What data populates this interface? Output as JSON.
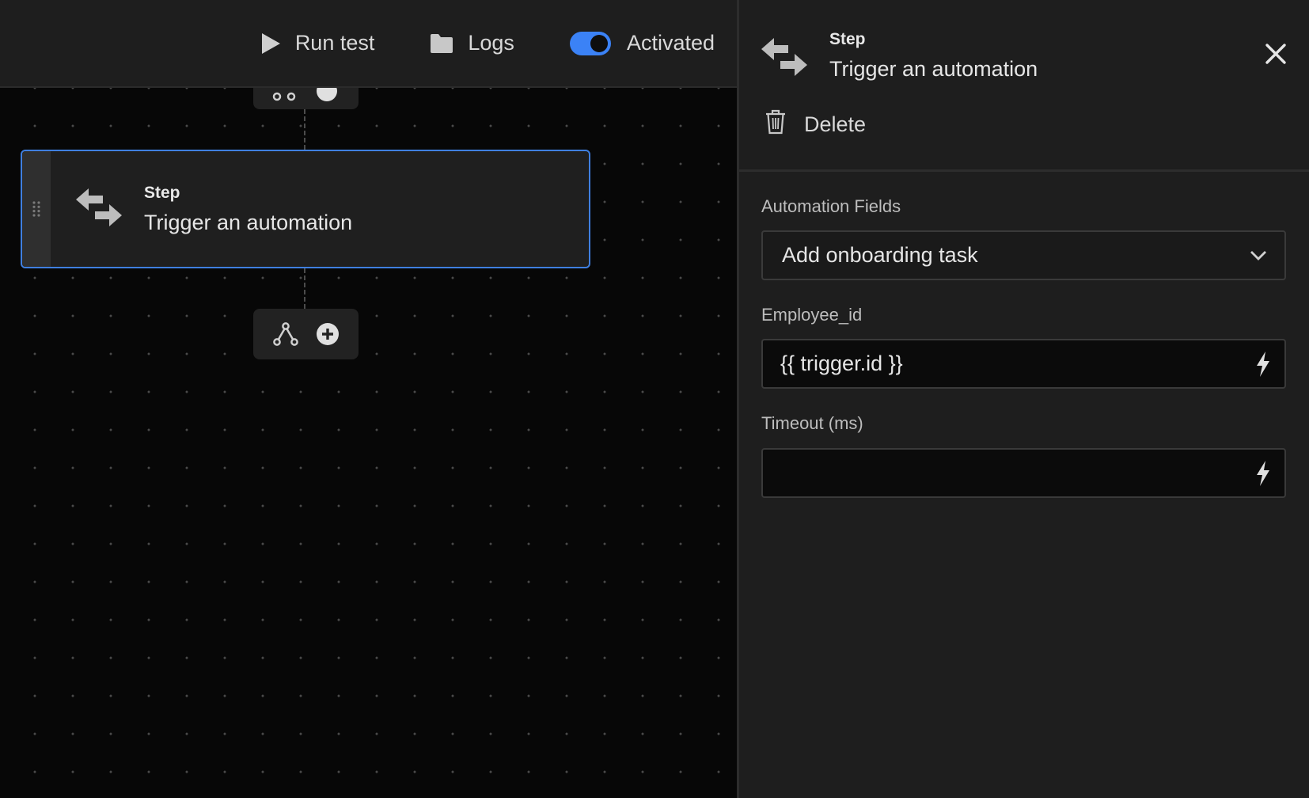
{
  "toolbar": {
    "run_test_label": "Run test",
    "logs_label": "Logs",
    "activated_label": "Activated",
    "activated": true
  },
  "canvas": {
    "step_card": {
      "type": "Step",
      "title": "Trigger an automation",
      "icon": "swap-arrows-icon"
    }
  },
  "panel": {
    "header": {
      "type": "Step",
      "title": "Trigger an automation",
      "icon": "swap-arrows-icon"
    },
    "delete_label": "Delete",
    "fields": {
      "automation_label": "Automation Fields",
      "automation_value": "Add onboarding task",
      "employee_id_label": "Employee_id",
      "employee_id_value": "{{ trigger.id }}",
      "timeout_label": "Timeout (ms)",
      "timeout_value": ""
    }
  },
  "colors": {
    "accent": "#3b82f6",
    "panel_bg": "#1e1e1e",
    "canvas_bg": "#070707"
  }
}
